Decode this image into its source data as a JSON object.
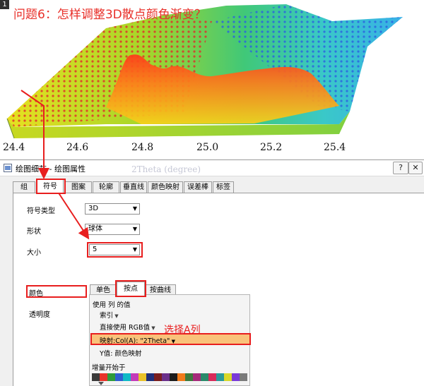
{
  "step_number": "1",
  "question": "问题6：怎样调整3D散点颜色渐变？",
  "plot": {
    "x_ticks": [
      "24.4",
      "24.6",
      "24.8",
      "25.0",
      "25.2",
      "25.4"
    ],
    "x_axis_title": "2Theta (degree)"
  },
  "dialog": {
    "title": "绘图细节 - 绘图属性",
    "help_button": "?",
    "close_button": "✕",
    "tabs": [
      "组",
      "符号",
      "图案",
      "轮廓",
      "垂直线",
      "颜色映射",
      "误差棒",
      "标签"
    ],
    "active_tab": "符号",
    "symbol_type_label": "符号类型",
    "symbol_type_value": "3D",
    "shape_label": "形状",
    "shape_value": "球体",
    "size_label": "大小",
    "size_value": "5",
    "color_label": "颜色",
    "transparency_label": "透明度",
    "color_tabs": [
      "单色",
      "按点",
      "按曲线"
    ],
    "active_color_tab": "按点",
    "use_column_values": "使用 列 的值",
    "index_option": "索引",
    "direct_rgb_option": "直接使用 RGB值",
    "mapping_option": "映射:Col(A): \"2Theta\"",
    "y_value_option": "Y值: 颜色映射",
    "increment_start_label": "增量开始于",
    "palette_colors": [
      "#3a3a3a",
      "#e8332a",
      "#2e9b3a",
      "#2f5fd0",
      "#0fb9c6",
      "#c43ab8",
      "#e8c22a",
      "#1f2f7a",
      "#7a1d1d",
      "#6a2f8a",
      "#1c1c1c",
      "#f07a1a",
      "#3c7a3c",
      "#a52a7a",
      "#2a8a6a",
      "#d82a5a",
      "#2a9a9a",
      "#d8d82a",
      "#7a3ad8",
      "#7a7a7a"
    ]
  },
  "annotation": {
    "select_column_text": "选择A列",
    "highlight_color": "#e81e1e"
  }
}
